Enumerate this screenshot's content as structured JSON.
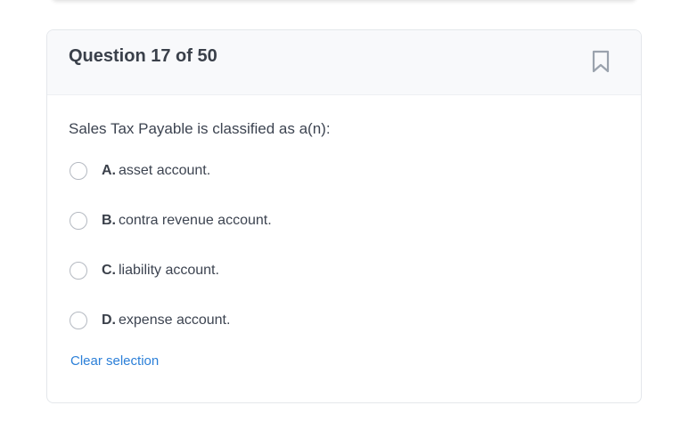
{
  "question": {
    "title": "Question 17 of 50",
    "prompt": "Sales Tax Payable is classified as a(n):",
    "options": [
      {
        "letter": "A.",
        "text": "asset account."
      },
      {
        "letter": "B.",
        "text": "contra revenue account."
      },
      {
        "letter": "C.",
        "text": "liability account."
      },
      {
        "letter": "D.",
        "text": "expense account."
      }
    ],
    "clear_label": "Clear selection"
  },
  "icons": {
    "bookmark": "bookmark-icon",
    "radio": "radio-circle"
  },
  "colors": {
    "link": "#2b7fd8",
    "header_bg": "#f8f9fb",
    "border": "#e4e7eb",
    "icon": "#9aa2ad"
  }
}
